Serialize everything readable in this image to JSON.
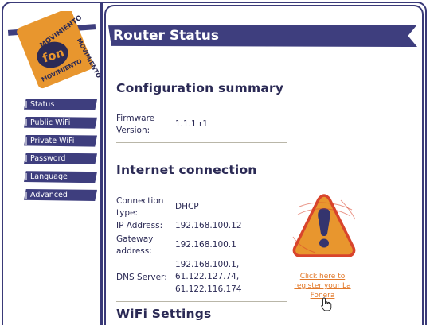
{
  "logo": {
    "brand": "fon",
    "text_top": "MOVIMIENTO",
    "text_right": "MOVIMIENTO",
    "text_bottom": "MOVIMIENTO"
  },
  "sidebar": {
    "items": [
      {
        "label": "Status"
      },
      {
        "label": "Public WiFi"
      },
      {
        "label": "Private WiFi"
      },
      {
        "label": "Password"
      },
      {
        "label": "Language"
      },
      {
        "label": "Advanced"
      }
    ]
  },
  "header": {
    "title": "Router Status"
  },
  "config_summary": {
    "heading": "Configuration summary",
    "firmware_label_line1": "Firmware",
    "firmware_label_line2": "Version:",
    "firmware_value": "1.1.1 r1"
  },
  "internet": {
    "heading": "Internet connection",
    "connection_type_label_line1": "Connection",
    "connection_type_label_line2": "type:",
    "connection_type_value": "DHCP",
    "ip_label": "IP Address:",
    "ip_value": "192.168.100.12",
    "gateway_label_line1": "Gateway",
    "gateway_label_line2": "address:",
    "gateway_value": "192.168.100.1",
    "dns_label": "DNS Server:",
    "dns_values": [
      "192.168.100.1,",
      "61.122.127.74,",
      "61.122.116.174"
    ]
  },
  "register": {
    "icon": "warning-icon",
    "link_lines": [
      "Click here to",
      "register your La",
      "Fonera"
    ]
  },
  "wifi": {
    "heading": "WiFi Settings"
  },
  "colors": {
    "brand_navy": "#3e3e7e",
    "text": "#2b2a55",
    "accent_orange": "#e8962e",
    "link_orange": "#e2792a"
  }
}
